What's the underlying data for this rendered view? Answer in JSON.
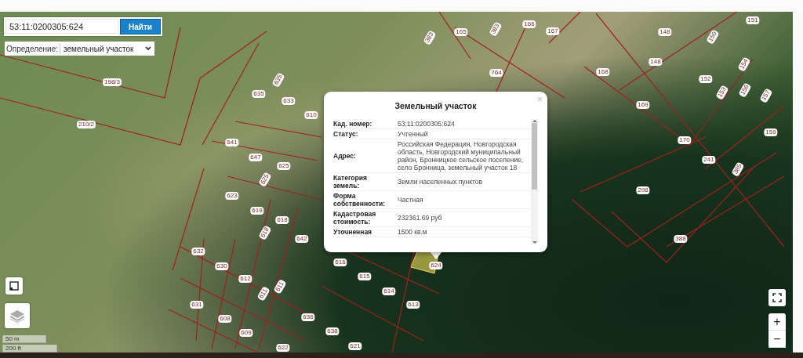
{
  "search": {
    "value": "53:11:0200305:624",
    "button": "Найти"
  },
  "definition": {
    "label": "Определение:",
    "value": "земельный участок"
  },
  "parcel_labels": [
    "198/3",
    "210/2",
    "635",
    "635",
    "633",
    "610",
    "641",
    "647",
    "625",
    "625",
    "623",
    "619",
    "618",
    "618",
    "642",
    "632",
    "630",
    "612",
    "611",
    "611",
    "616",
    "615",
    "614",
    "613",
    "631",
    "608",
    "609",
    "636",
    "638",
    "621",
    "622",
    "383",
    "165",
    "383",
    "166",
    "167",
    "764",
    "168",
    "148",
    "148",
    "150",
    "151",
    "152",
    "153",
    "154",
    "156",
    "157",
    "159",
    "169",
    "170",
    "241",
    "385",
    "298",
    "388",
    "624"
  ],
  "popup": {
    "title": "Земельный участок",
    "close": "×",
    "rows": [
      {
        "label": "Кад. номер:",
        "value": "53:11:0200305:624"
      },
      {
        "label": "Статус:",
        "value": "Учтенный"
      },
      {
        "label": "Адрес:",
        "value": "Российская Федерация, Новгородская область, Новгородский муниципальный район, Бронницкое сельское поселение, село Бронница, земельный участок 18"
      },
      {
        "label": "Категория земель:",
        "value": "Земли населенных пунктов"
      },
      {
        "label": "Форма собственности:",
        "value": "Частная"
      },
      {
        "label": "Кадастровая стоимость:",
        "value": "232361.69 руб"
      },
      {
        "label": "Уточненная",
        "value": "1500 кв.м"
      }
    ]
  },
  "scale": [
    "50 m",
    "200 ft"
  ],
  "zoom": {
    "in": "+",
    "out": "−"
  }
}
